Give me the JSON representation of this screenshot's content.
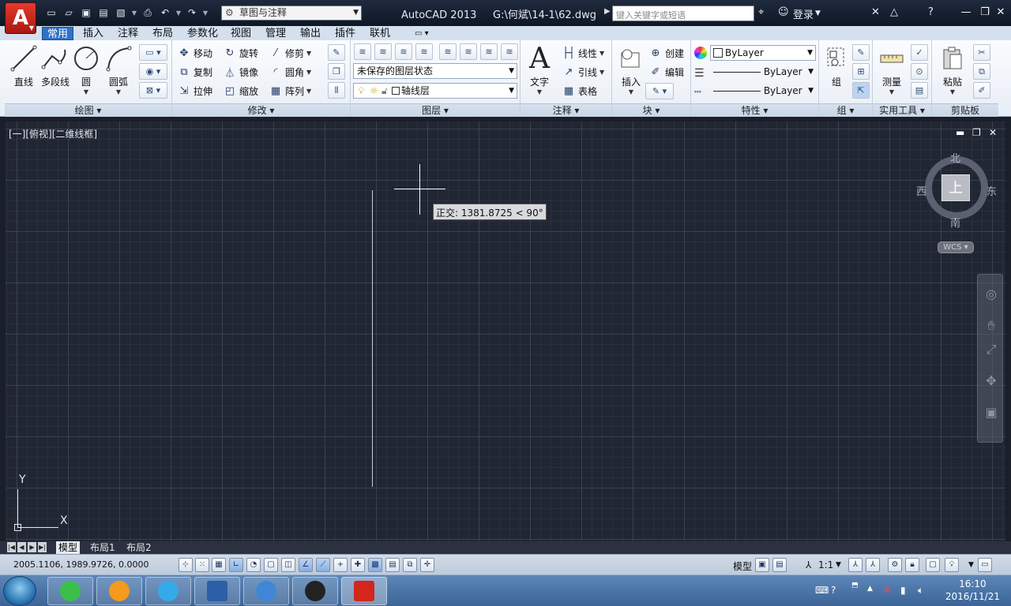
{
  "titlebar": {
    "app_menu_icon": "autocad-logo-icon",
    "app_menu_letter": "A",
    "workspace": "草图与注释",
    "title": "AutoCAD 2013     G:\\何斌\\14-1\\62.dwg",
    "search_placeholder": "键入关键字或短语",
    "login": "登录"
  },
  "tabs": [
    "常用",
    "插入",
    "注释",
    "布局",
    "参数化",
    "视图",
    "管理",
    "输出",
    "插件",
    "联机"
  ],
  "ribbon": {
    "draw": {
      "title": "绘图",
      "line": "直线",
      "polyline": "多段线",
      "circle": "圆",
      "arc": "圆弧"
    },
    "modify": {
      "title": "修改",
      "move": "移动",
      "rotate": "旋转",
      "trim": "修剪",
      "copy": "复制",
      "mirror": "镜像",
      "fillet": "圆角",
      "stretch": "拉伸",
      "scale": "缩放",
      "array": "阵列"
    },
    "layers": {
      "title": "图层",
      "layer_state": "未保存的图层状态",
      "current_layer": "轴线层"
    },
    "annotation": {
      "title": "注释",
      "text": "文字",
      "linear": "线性",
      "leader": "引线",
      "table": "表格"
    },
    "block": {
      "title": "块",
      "insert": "插入",
      "create": "创建",
      "edit": "编辑"
    },
    "properties": {
      "title": "特性",
      "color": "ByLayer",
      "linetype": "ByLayer",
      "lineweight": "ByLayer"
    },
    "groups": {
      "title": "组",
      "group": "组"
    },
    "utilities": {
      "title": "实用工具",
      "measure": "测量"
    },
    "clipboard": {
      "title": "剪贴板",
      "paste": "粘贴"
    }
  },
  "viewport": {
    "label": "[一][俯视][二维线框]",
    "tooltip": "正交: 1381.8725 < 90°",
    "viewcube": {
      "top": "上",
      "north": "北",
      "south": "南",
      "east": "东",
      "west": "西",
      "wcs": "WCS"
    },
    "ucs_x": "X",
    "ucs_y": "Y"
  },
  "layout_tabs": [
    "模型",
    "布局1",
    "布局2"
  ],
  "statusbar": {
    "coordinates": "2005.1106, 1989.9726, 0.0000",
    "model": "模型",
    "annotation_scale": "1:1"
  },
  "taskbar": {
    "time": "16:10",
    "date": "2016/11/21"
  },
  "colors": {
    "canvas": "#212633",
    "ribbon_tab_active": "#2f72c8",
    "autocad_red": "#d3261c"
  }
}
